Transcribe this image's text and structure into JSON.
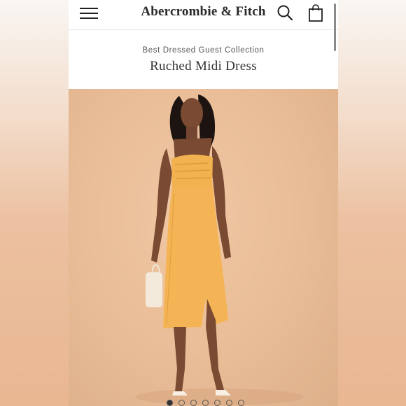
{
  "header": {
    "brand": "Abercrombie & Fitch",
    "menu_icon": "hamburger-menu-icon",
    "search_icon": "search-icon",
    "bag_icon": "shopping-bag-icon"
  },
  "product": {
    "collection": "Best Dressed Guest Collection",
    "title": "Ruched Midi Dress",
    "dress_color": "#f2b24f"
  },
  "gallery": {
    "dots": [
      true,
      false,
      false,
      false,
      false,
      false,
      false
    ]
  },
  "colors": {
    "background": "#e8bc96",
    "text": "#2a2a2a"
  }
}
